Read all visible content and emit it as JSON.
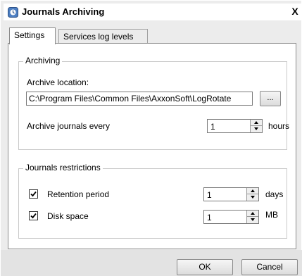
{
  "window": {
    "title": "Journals Archiving",
    "close_glyph": "X"
  },
  "tabs": [
    {
      "label": "Settings",
      "active": true
    },
    {
      "label": "Services log levels",
      "active": false
    }
  ],
  "archiving": {
    "group_label": "Archiving",
    "location_label": "Archive location:",
    "location_value": "C:\\Program Files\\Common Files\\AxxonSoft\\LogRotate",
    "browse_label": "...",
    "every_label": "Archive journals every",
    "every_value": "1",
    "every_unit": "hours"
  },
  "restrictions": {
    "group_label": "Journals restrictions",
    "retention": {
      "label": "Retention period",
      "checked": true,
      "value": "1",
      "unit": "days"
    },
    "disk": {
      "label": "Disk space",
      "checked": true,
      "value": "1",
      "unit": "MB"
    }
  },
  "buttons": {
    "ok": "OK",
    "cancel": "Cancel"
  },
  "icons": {
    "app": "journal-app-icon",
    "checkbox": "checkmark-icon"
  }
}
